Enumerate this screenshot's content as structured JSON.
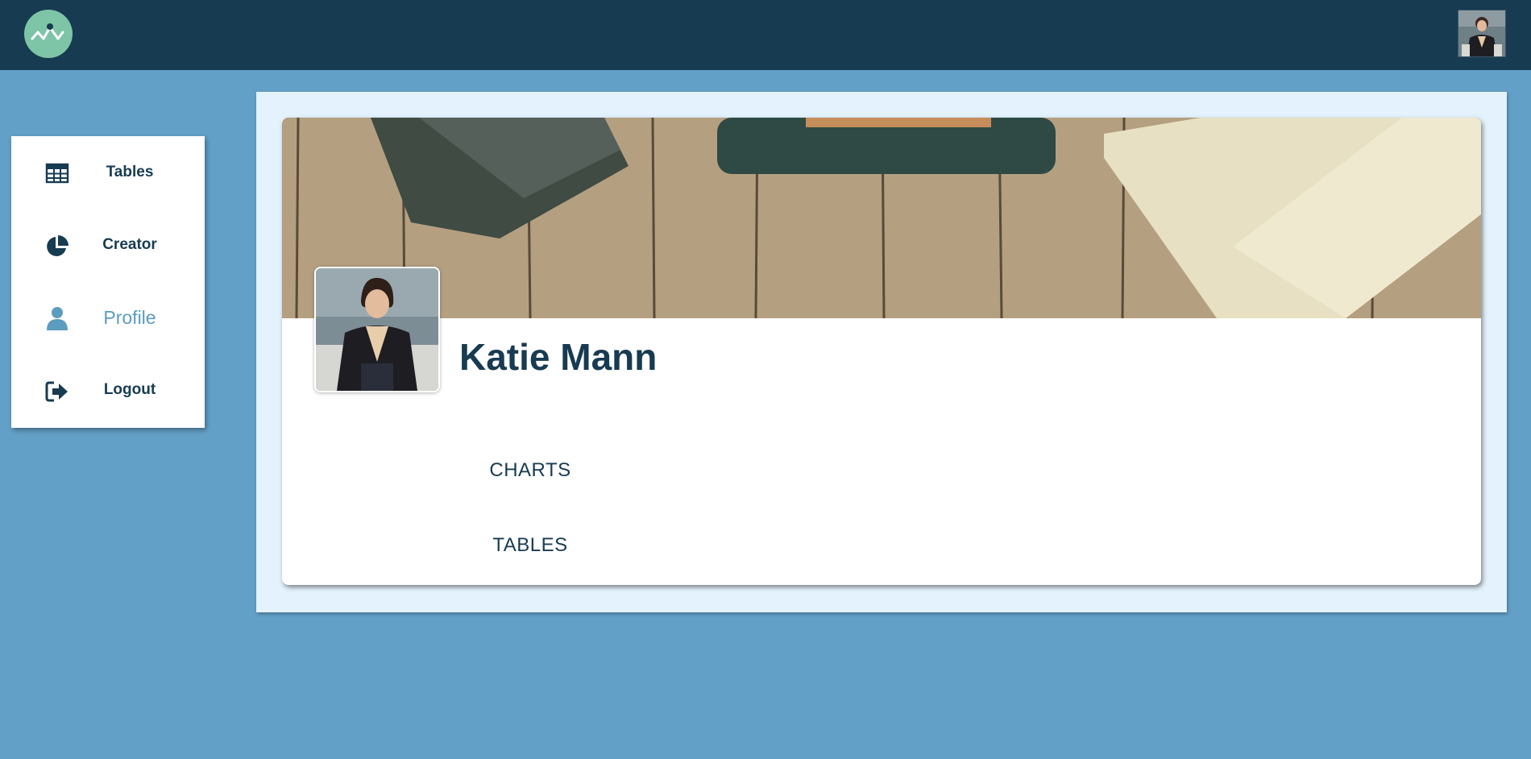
{
  "header": {
    "logo_icon": "activity-pulse-icon",
    "avatar_icon": "user-avatar-photo"
  },
  "sidebar": {
    "items": [
      {
        "label": "Tables",
        "icon": "table-icon"
      },
      {
        "label": "Creator",
        "icon": "pie-chart-icon"
      },
      {
        "label": "Profile",
        "icon": "user-icon",
        "active": true
      },
      {
        "label": "Logout",
        "icon": "sign-out-icon"
      }
    ]
  },
  "profile": {
    "name": "Katie Mann",
    "links": [
      "CHARTS",
      "TABLES"
    ]
  },
  "colors": {
    "topbar": "#173b51",
    "background": "#63a0c7",
    "panel": "#e3f2fd",
    "accent": "#5b9cbf",
    "logo": "#7ec4a6"
  }
}
